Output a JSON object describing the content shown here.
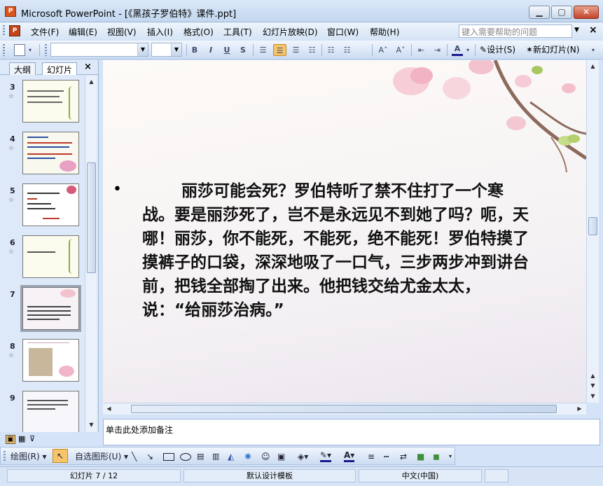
{
  "window": {
    "title": "Microsoft PowerPoint - [《黑孩子罗伯特》课件.ppt]"
  },
  "menu": {
    "items": [
      "文件(F)",
      "编辑(E)",
      "视图(V)",
      "插入(I)",
      "格式(O)",
      "工具(T)",
      "幻灯片放映(D)",
      "窗口(W)",
      "帮助(H)"
    ],
    "help_placeholder": "键入需要帮助的问题"
  },
  "toolbar": {
    "bold": "B",
    "italic": "I",
    "underline": "U",
    "shadow": "S",
    "grow_font": "A˄",
    "shrink_font": "A˅",
    "font_color": "A",
    "design_label": "设计(S)",
    "new_slide_label": "新幻灯片(N)"
  },
  "left_pane": {
    "tab_outline": "大纲",
    "tab_slides": "幻灯片",
    "slides": [
      {
        "number": "3"
      },
      {
        "number": "4"
      },
      {
        "number": "5"
      },
      {
        "number": "6"
      },
      {
        "number": "7"
      },
      {
        "number": "8"
      },
      {
        "number": "9"
      }
    ],
    "selected_slide": "7"
  },
  "slide": {
    "bullet": "•",
    "body_text": "丽莎可能会死？罗伯特听了禁不住打了一个寒战。要是丽莎死了，岂不是永远见不到她了吗？呃，天哪！丽莎，你不能死，不能死，绝不能死！罗伯特摸了摸裤子的口袋，深深地吸了一口气，三步两步冲到讲台前，把钱全部掏了出来。他把钱交给尤金太太，说：“给丽莎治病。”"
  },
  "notes": {
    "placeholder": "单击此处添加备注"
  },
  "draw_toolbar": {
    "draw_label": "绘图(R)",
    "autoshape_label": "自选图形(U)"
  },
  "status": {
    "slide_info": "幻灯片 7 / 12",
    "template": "默认设计模板",
    "language": "中文(中国)"
  },
  "colors": {
    "selected_button": "#f7c46b",
    "close_button": "#c3432a",
    "font_color_underline": "#1a1a8c"
  }
}
